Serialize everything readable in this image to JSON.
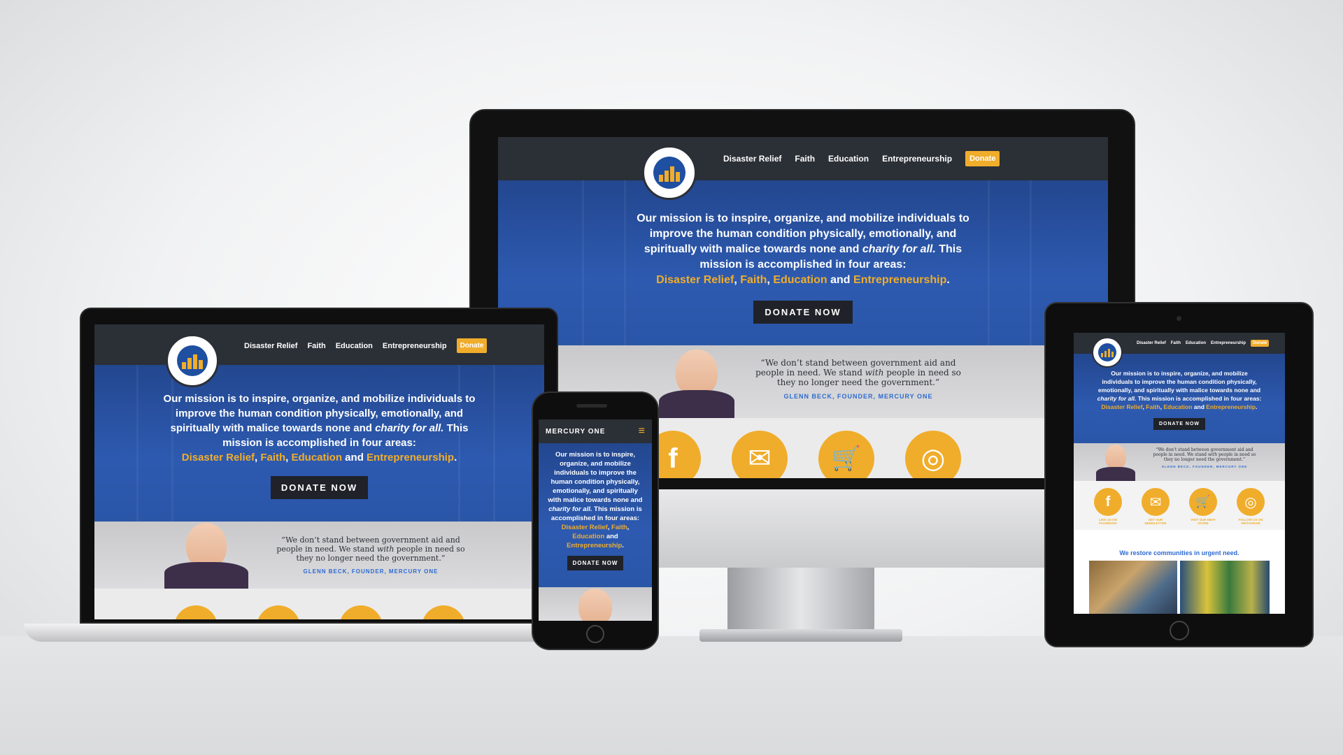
{
  "site": {
    "brand": "MERCURY ONE",
    "nav": [
      "Disaster Relief",
      "Faith",
      "Education",
      "Entrepreneurship"
    ],
    "donate_nav": "Donate",
    "mission_a": "Our mission is to inspire, organize, and mobilize individuals to improve the human condition physically, emotionally, and spiritually with malice towards none and ",
    "mission_italic": "charity for all.",
    "mission_b": " This mission is accomplished in four areas:",
    "areas": [
      "Disaster Relief",
      "Faith",
      "Education",
      "Entrepreneurship"
    ],
    "sep_comma": ", ",
    "sep_and": " and ",
    "period": ".",
    "donate_button": "DONATE NOW",
    "quote_a": "“We don’t stand between government aid and people in need. We stand ",
    "quote_italic": "with",
    "quote_b": " people in need so they no longer need the government.”",
    "quote_by": "GLENN BECK, FOUNDER, MERCURY ONE",
    "icon_labels": [
      "LIKE US ON FACEBOOK",
      "GET OUR NEWSLETTER",
      "VISIT OUR EBAY STORE",
      "FOLLOW US ON INSTAGRAM"
    ],
    "tagline": "We restore communities in urgent need.",
    "icon_glyphs": [
      "f",
      "✉",
      "🛒",
      "◎"
    ]
  },
  "colors": {
    "accent": "#f0ad2b",
    "nav": "#2b2f36",
    "hero": "#2d5ab0",
    "link": "#2d6ad0"
  }
}
